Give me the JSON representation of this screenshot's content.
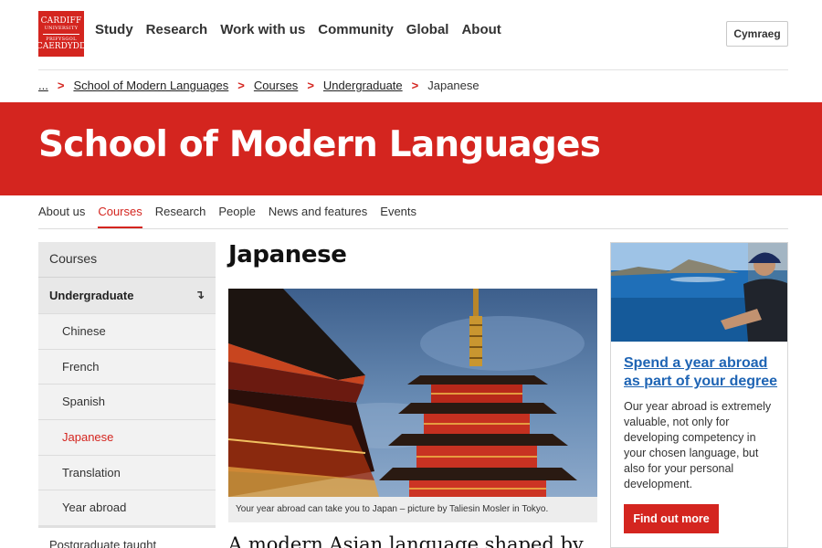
{
  "header": {
    "logo": {
      "line1": "CARDIFF",
      "line2": "UNIVERSITY",
      "line3": "PRIFYSGOL",
      "line4": "CAERDYDD"
    },
    "nav": [
      "Study",
      "Research",
      "Work with us",
      "Community",
      "Global",
      "About"
    ],
    "language_button": "Cymraeg"
  },
  "breadcrumb": {
    "ellipsis": "...",
    "items": [
      "School of Modern Languages",
      "Courses",
      "Undergraduate"
    ],
    "current": "Japanese",
    "separator": ">"
  },
  "banner": {
    "title": "School of Modern Languages"
  },
  "subnav": {
    "items": [
      "About us",
      "Courses",
      "Research",
      "People",
      "News and features",
      "Events"
    ],
    "active": "Courses"
  },
  "sidenav": {
    "heading": "Courses",
    "group": "Undergraduate",
    "group_arrow": "↴",
    "items": [
      "Chinese",
      "French",
      "Spanish",
      "Japanese",
      "Translation",
      "Year abroad"
    ],
    "active": "Japanese",
    "next_group": "Postgraduate taught"
  },
  "main": {
    "title": "Japanese",
    "caption": "Your year abroad can take you to Japan – picture by Taliesin Mosler in Tokyo.",
    "intro": "A modern Asian language shaped by"
  },
  "promo": {
    "title": "Spend a year abroad as part of your degree",
    "body": "Our year abroad is extremely valuable, not only for developing competency in your chosen language, but also for your personal development.",
    "button": "Find out more"
  },
  "colors": {
    "brand_red": "#d4251f",
    "link_blue": "#1e64b4",
    "sidebar_bg": "#e8e8e8"
  }
}
